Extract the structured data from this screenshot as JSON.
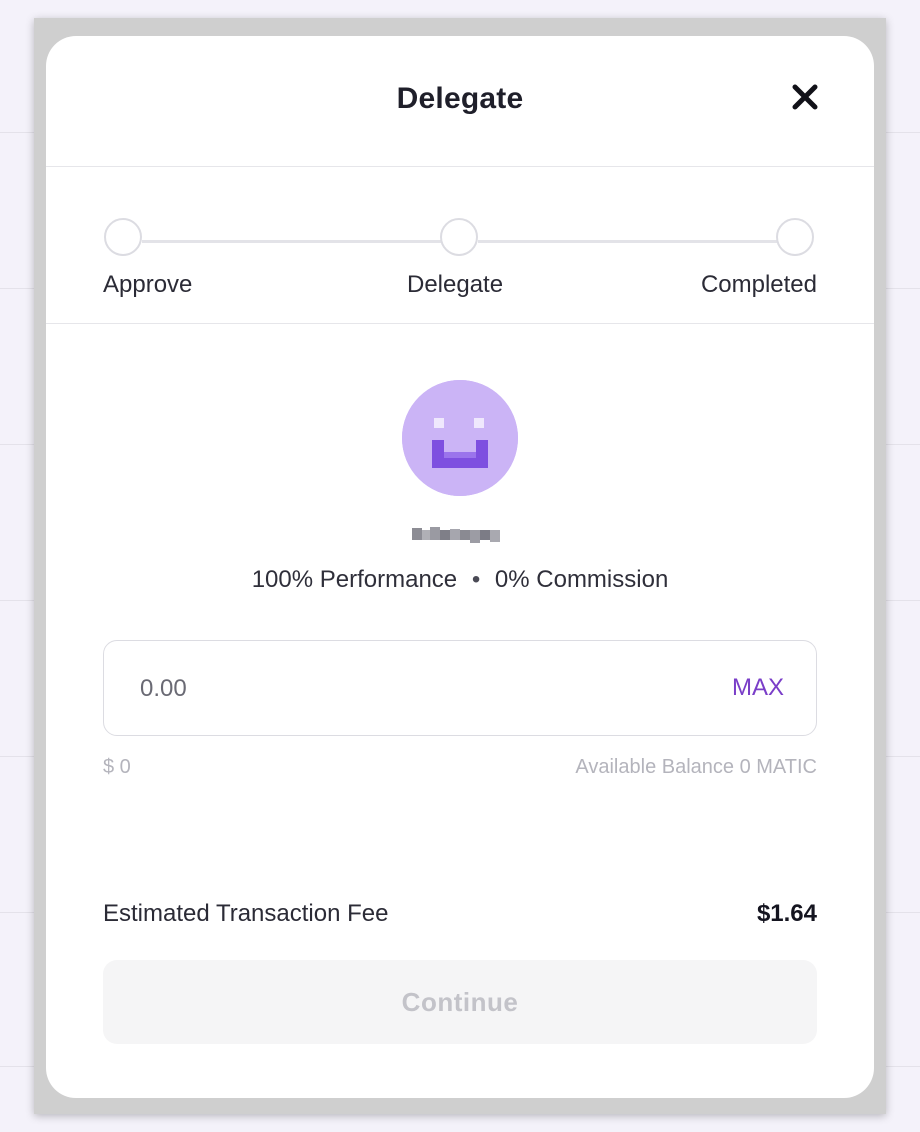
{
  "modal": {
    "title": "Delegate"
  },
  "stepper": {
    "steps": [
      {
        "label": "Approve"
      },
      {
        "label": "Delegate"
      },
      {
        "label": "Completed"
      }
    ]
  },
  "validator": {
    "name_blurred": true,
    "performance": "100% Performance",
    "separator": "•",
    "commission": "0% Commission"
  },
  "amount": {
    "placeholder": "0.00",
    "value": "",
    "max_label": "MAX",
    "usd_value": "$ 0",
    "available_balance": "Available Balance 0 MATIC"
  },
  "fee": {
    "label": "Estimated Transaction Fee",
    "value": "$1.64"
  },
  "actions": {
    "continue_label": "Continue",
    "continue_enabled": false
  },
  "colors": {
    "accent": "#7a3ec8",
    "avatar_bg": "#cbb4f6",
    "avatar_face": "#7e4fe0"
  }
}
